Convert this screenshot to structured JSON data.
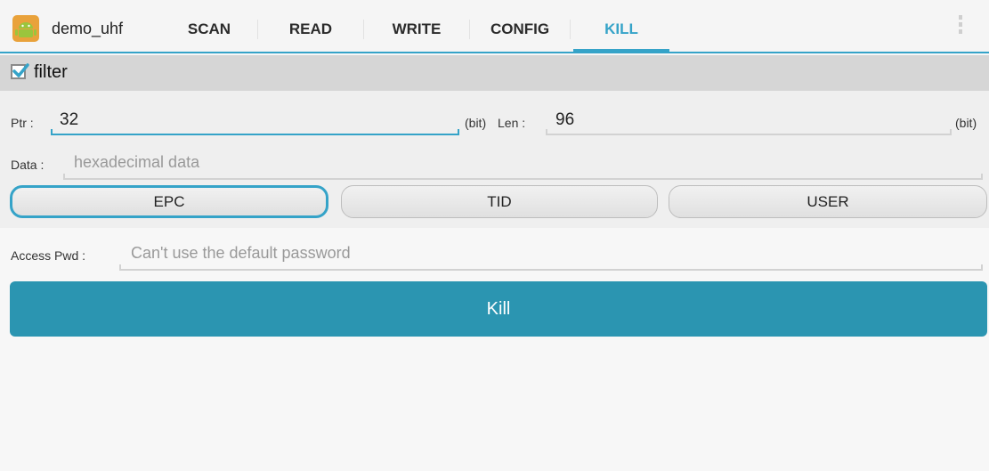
{
  "app": {
    "title": "demo_uhf",
    "accent_color": "#35a3c8",
    "icon": "android-robot-icon"
  },
  "tabs": [
    {
      "label": "SCAN",
      "active": false
    },
    {
      "label": "READ",
      "active": false
    },
    {
      "label": "WRITE",
      "active": false
    },
    {
      "label": "CONFIG",
      "active": false
    },
    {
      "label": "KILL",
      "active": true
    }
  ],
  "filter": {
    "checkbox_label": "filter",
    "checked": true,
    "ptr_label": "Ptr :",
    "ptr_value": "32",
    "ptr_unit": "(bit)",
    "len_label": "Len :",
    "len_value": "96",
    "len_unit": "(bit)",
    "data_label": "Data :",
    "data_placeholder": "hexadecimal data",
    "banks": [
      {
        "label": "EPC",
        "selected": true
      },
      {
        "label": "TID",
        "selected": false
      },
      {
        "label": "USER",
        "selected": false
      }
    ]
  },
  "access": {
    "label": "Access Pwd :",
    "placeholder": "Can't use the default password"
  },
  "kill_button": {
    "label": "Kill",
    "color": "#2b95b1"
  }
}
